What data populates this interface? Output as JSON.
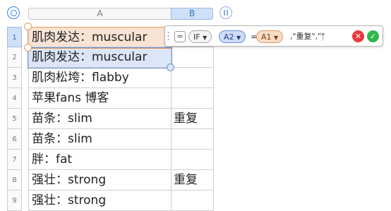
{
  "columns": {
    "a": "A",
    "b": "B"
  },
  "rows": [
    {
      "num": "1",
      "a": "肌肉发达：muscular",
      "b": ""
    },
    {
      "num": "2",
      "a": "肌肉发达：muscular",
      "b": ""
    },
    {
      "num": "3",
      "a": "肌肉松垮：flabby",
      "b": ""
    },
    {
      "num": "4",
      "a": "苹果fans 博客",
      "b": ""
    },
    {
      "num": "5",
      "a": "苗条：slim",
      "b": "重复"
    },
    {
      "num": "6",
      "a": "苗条：slim",
      "b": ""
    },
    {
      "num": "7",
      "a": "胖：fat",
      "b": ""
    },
    {
      "num": "8",
      "a": "强壮：strong",
      "b": "重复"
    },
    {
      "num": "9",
      "a": "强壮：strong",
      "b": ""
    }
  ],
  "formula": {
    "equals": "=",
    "function": "IF",
    "ref1": "A2",
    "operator": "=",
    "ref2": "A1",
    "rest": ",\"重复\",\"\"",
    "close": ")",
    "dropdown_icon": "▼"
  },
  "icons": {
    "cancel": "✕",
    "accept": "✓"
  }
}
